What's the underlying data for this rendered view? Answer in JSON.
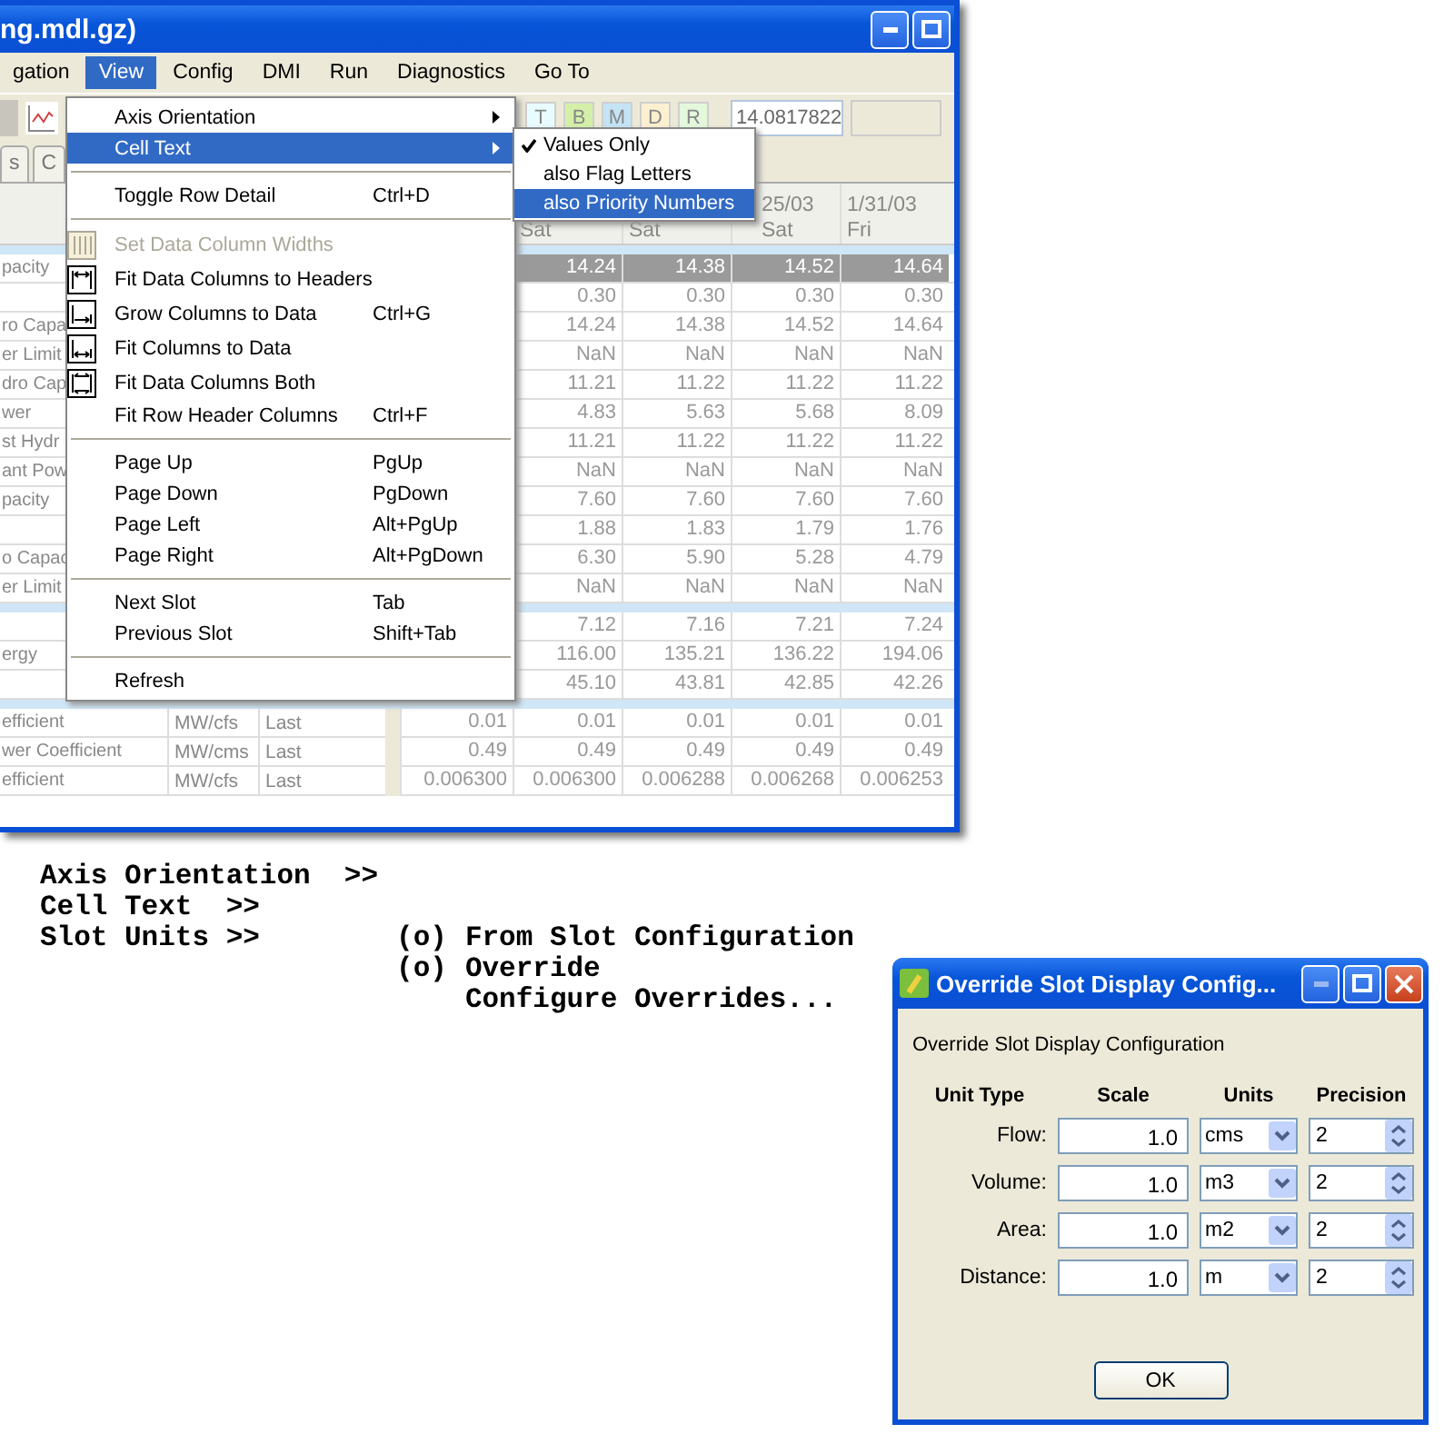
{
  "app_window": {
    "title": "ng.mdl.gz)",
    "menu_bar": [
      {
        "label": "gation",
        "selected": false
      },
      {
        "label": "View",
        "selected": true
      },
      {
        "label": "Config",
        "selected": false
      },
      {
        "label": "DMI",
        "selected": false
      },
      {
        "label": "Run",
        "selected": false
      },
      {
        "label": "Diagnostics",
        "selected": false
      },
      {
        "label": "Go To",
        "selected": false
      }
    ],
    "toolbar": {
      "flags": [
        {
          "label": "T",
          "color": "#e8fcff"
        },
        {
          "label": "B",
          "color": "#d4f0a8"
        },
        {
          "label": "M",
          "color": "#c4e4f4"
        },
        {
          "label": "D",
          "color": "#fcf0d0"
        },
        {
          "label": "R",
          "color": "#e4f8dc"
        }
      ],
      "value_field": "14.0817822"
    },
    "tabs": [
      {
        "label": "s",
        "selected": false
      },
      {
        "label": "C",
        "selected": false
      }
    ],
    "table": {
      "headers": [
        {
          "day": "Sat"
        },
        {
          "day": "Sat"
        },
        {
          "date": "25/03",
          "day": "Sat"
        },
        {
          "date": "1/31/03",
          "day": "Fri"
        }
      ],
      "sections": [
        {
          "rows": [
            {
              "label": "pacity",
              "selected": true,
              "values": [
                "14.24",
                "14.38",
                "14.52",
                "14.64"
              ]
            },
            {
              "selected": false,
              "values": [
                "0.30",
                "0.30",
                "0.30",
                "0.30"
              ]
            },
            {
              "label": "ro Capa",
              "selected": false,
              "values": [
                "14.24",
                "14.38",
                "14.52",
                "14.64"
              ]
            },
            {
              "label": "er Limit",
              "selected": false,
              "values": [
                "NaN",
                "NaN",
                "NaN",
                "NaN"
              ]
            },
            {
              "label": "dro Cap",
              "selected": false,
              "values": [
                "11.21",
                "11.22",
                "11.22",
                "11.22"
              ]
            },
            {
              "label": "wer",
              "selected": false,
              "values": [
                "4.83",
                "5.63",
                "5.68",
                "8.09"
              ]
            },
            {
              "label": "st Hydr",
              "selected": false,
              "values": [
                "11.21",
                "11.22",
                "11.22",
                "11.22"
              ]
            },
            {
              "label": "ant Pow",
              "selected": false,
              "values": [
                "NaN",
                "NaN",
                "NaN",
                "NaN"
              ]
            },
            {
              "label": "pacity",
              "selected": false,
              "values": [
                "7.60",
                "7.60",
                "7.60",
                "7.60"
              ]
            },
            {
              "selected": false,
              "values": [
                "1.88",
                "1.83",
                "1.79",
                "1.76"
              ]
            },
            {
              "label": "o Capac",
              "selected": false,
              "values": [
                "6.30",
                "5.90",
                "5.28",
                "4.79"
              ]
            },
            {
              "label": "er Limit",
              "selected": false,
              "values": [
                "NaN",
                "NaN",
                "NaN",
                "NaN"
              ]
            }
          ]
        },
        {
          "rows": [
            {
              "selected": false,
              "values": [
                "7.12",
                "7.16",
                "7.21",
                "7.24"
              ]
            },
            {
              "label": "ergy",
              "selected": false,
              "values": [
                "116.00",
                "135.21",
                "136.22",
                "194.06"
              ]
            },
            {
              "selected": false,
              "values": [
                "45.10",
                "43.81",
                "42.85",
                "42.26"
              ]
            }
          ]
        },
        {
          "rows": [
            {
              "label": "efficient",
              "units": "MW/cfs",
              "last": "Last",
              "first_value": "0.01",
              "selected": false,
              "values": [
                "0.01",
                "0.01",
                "0.01",
                "0.01"
              ]
            },
            {
              "label": "wer Coefficient",
              "units": "MW/cms",
              "last": "Last",
              "first_value": "0.49",
              "selected": false,
              "values": [
                "0.49",
                "0.49",
                "0.49",
                "0.49"
              ]
            },
            {
              "label": "efficient",
              "units": "MW/cfs",
              "last": "Last",
              "first_value": "0.006300",
              "selected": false,
              "values": [
                "0.006300",
                "0.006288",
                "0.006268",
                "0.006253"
              ]
            }
          ]
        }
      ]
    },
    "view_menu": [
      {
        "kind": "item",
        "label": "Axis Orientation",
        "submenu": true,
        "selected": false,
        "disabled": false
      },
      {
        "kind": "item",
        "label": "Cell Text",
        "submenu": true,
        "selected": true,
        "disabled": false
      },
      {
        "kind": "separator"
      },
      {
        "kind": "item",
        "label": "Toggle Row Detail",
        "shortcut": "Ctrl+D",
        "submenu": false,
        "selected": false,
        "disabled": false
      },
      {
        "kind": "separator"
      },
      {
        "kind": "icon-item",
        "label": "Set Data Column Widths",
        "submenu": false,
        "selected": false,
        "disabled": true
      },
      {
        "kind": "icon-item",
        "label": "Fit Data Columns to Headers",
        "submenu": false,
        "selected": false,
        "disabled": false
      },
      {
        "kind": "icon-item",
        "label": "Grow Columns to Data",
        "shortcut": "Ctrl+G",
        "submenu": false,
        "selected": false,
        "disabled": false
      },
      {
        "kind": "icon-item",
        "label": "Fit Columns to Data",
        "submenu": false,
        "selected": false,
        "disabled": false
      },
      {
        "kind": "icon-item",
        "label": "Fit Data Columns Both",
        "submenu": false,
        "selected": false,
        "disabled": false
      },
      {
        "kind": "item",
        "label": "Fit Row Header Columns",
        "shortcut": "Ctrl+F",
        "submenu": false,
        "selected": false,
        "disabled": false
      },
      {
        "kind": "separator"
      },
      {
        "kind": "item",
        "label": "Page Up",
        "shortcut": "PgUp",
        "submenu": false,
        "selected": false,
        "disabled": false
      },
      {
        "kind": "item",
        "label": "Page Down",
        "shortcut": "PgDown",
        "submenu": false,
        "selected": false,
        "disabled": false
      },
      {
        "kind": "item",
        "label": "Page Left",
        "shortcut": "Alt+PgUp",
        "submenu": false,
        "selected": false,
        "disabled": false
      },
      {
        "kind": "item",
        "label": "Page Right",
        "shortcut": "Alt+PgDown",
        "submenu": false,
        "selected": false,
        "disabled": false
      },
      {
        "kind": "separator"
      },
      {
        "kind": "item",
        "label": "Next Slot",
        "shortcut": "Tab",
        "submenu": false,
        "selected": false,
        "disabled": false
      },
      {
        "kind": "item",
        "label": "Previous Slot",
        "shortcut": "Shift+Tab",
        "submenu": false,
        "selected": false,
        "disabled": false
      },
      {
        "kind": "separator"
      },
      {
        "kind": "item",
        "label": "Refresh",
        "submenu": false,
        "selected": false,
        "disabled": false
      }
    ],
    "cell_text_submenu": [
      {
        "label": "Values Only",
        "checked": true,
        "selected": false
      },
      {
        "label": "also Flag Letters",
        "checked": false,
        "selected": false
      },
      {
        "label": "also Priority Numbers",
        "checked": false,
        "selected": true
      }
    ]
  },
  "outline": [
    {
      "text": "Axis Orientation  >>"
    },
    {
      "text": "Cell Text  >>"
    },
    {
      "text": "Slot Units >>",
      "options": [
        {
          "marker": "(o)",
          "text": "From Slot Configuration"
        },
        {
          "marker": "(o)",
          "text": "Override"
        },
        {
          "text": "Configure Overrides..."
        }
      ]
    }
  ],
  "dialog": {
    "title": "Override Slot Display Config...",
    "heading": "Override Slot Display Configuration",
    "columns": [
      "Unit Type",
      "Scale",
      "Units",
      "Precision"
    ],
    "rows": [
      {
        "label": "Flow:",
        "scale": "1.0",
        "units": "cms",
        "precision": "2"
      },
      {
        "label": "Volume:",
        "scale": "1.0",
        "units": "m3",
        "precision": "2"
      },
      {
        "label": "Area:",
        "scale": "1.0",
        "units": "m2",
        "precision": "2"
      },
      {
        "label": "Distance:",
        "scale": "1.0",
        "units": "m",
        "precision": "2"
      }
    ],
    "ok": "OK"
  }
}
